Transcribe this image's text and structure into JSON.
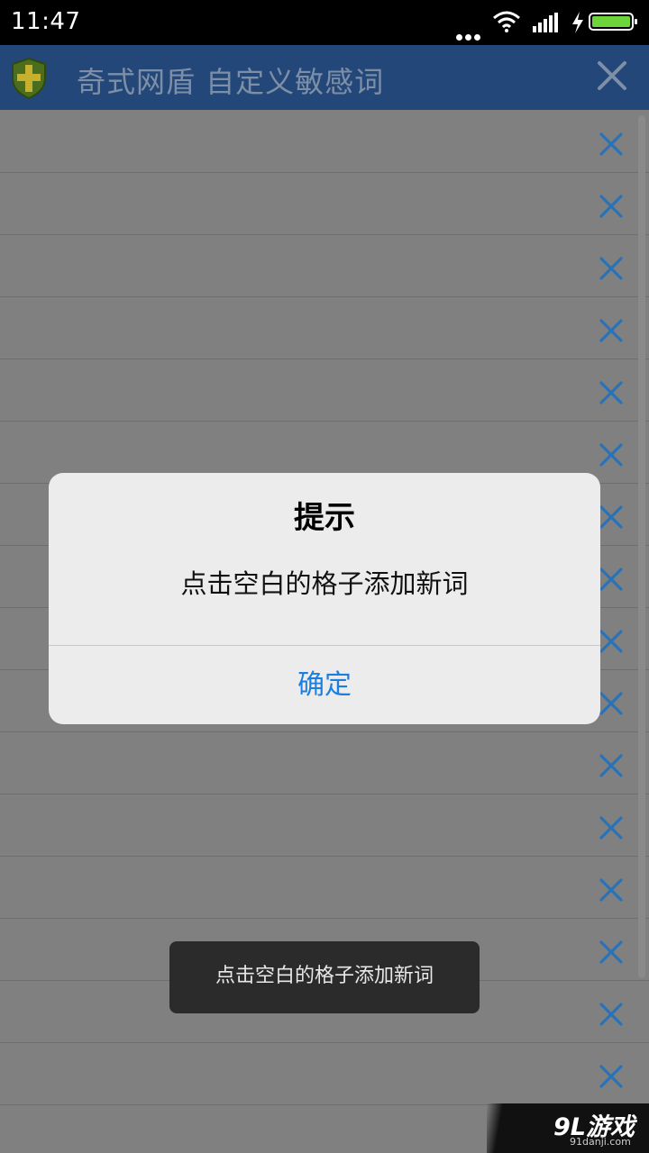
{
  "status_bar": {
    "time": "11:47"
  },
  "app_bar": {
    "title": "奇式网盾  自定义敏感词"
  },
  "list": {
    "rows": [
      {
        "text": ""
      },
      {
        "text": ""
      },
      {
        "text": ""
      },
      {
        "text": ""
      },
      {
        "text": ""
      },
      {
        "text": ""
      },
      {
        "text": ""
      },
      {
        "text": ""
      },
      {
        "text": ""
      },
      {
        "text": ""
      },
      {
        "text": ""
      },
      {
        "text": ""
      },
      {
        "text": ""
      },
      {
        "text": ""
      },
      {
        "text": ""
      },
      {
        "text": ""
      }
    ]
  },
  "dialog": {
    "title": "提示",
    "message": "点击空白的格子添加新词",
    "ok_label": "确定"
  },
  "toast": {
    "message": "点击空白的格子添加新词"
  },
  "watermark": {
    "brand": "9L游戏",
    "site": "91danji.com"
  },
  "colors": {
    "app_bar": "#24477a",
    "delete_icon": "#2a72b8",
    "dialog_button": "#1a7fe0",
    "battery": "#6ed43c"
  },
  "icons": [
    "shield-logo-icon",
    "close-icon",
    "delete-icon",
    "wifi-icon",
    "signal-icon",
    "charging-icon",
    "battery-icon"
  ]
}
